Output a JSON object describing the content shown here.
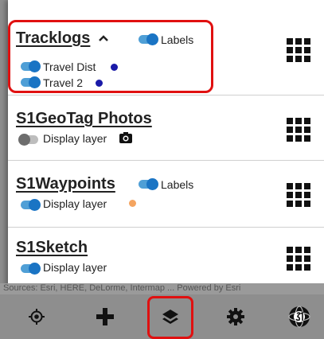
{
  "layers": [
    {
      "title": "Tracklogs",
      "labels_toggle": {
        "label": "Labels",
        "on": true
      },
      "tracks": [
        {
          "label": "Travel Dist",
          "on": true,
          "color": "#1a1aa8"
        },
        {
          "label": "Travel 2",
          "on": true,
          "color": "#1a1aa8"
        }
      ],
      "expanded": true,
      "highlighted": true
    },
    {
      "title": "S1GeoTag Photos",
      "display_toggle": {
        "label": "Display layer",
        "on": false
      }
    },
    {
      "title": "S1Waypoints",
      "labels_toggle": {
        "label": "Labels",
        "on": true
      },
      "display_toggle": {
        "label": "Display layer",
        "on": true
      },
      "color": "#f4a460"
    },
    {
      "title": "S1Sketch",
      "display_toggle": {
        "label": "Display layer",
        "on": true
      }
    }
  ],
  "attribution": "Sources: Esri, HERE, DeLorme, Intermap ... Powered by Esri",
  "toolbar": {
    "buttons": [
      {
        "icon": "gps-target-icon"
      },
      {
        "icon": "add-icon"
      },
      {
        "icon": "layers-icon",
        "active": true
      },
      {
        "icon": "settings-gear-icon"
      },
      {
        "icon": "s1-logo-icon"
      }
    ]
  },
  "colors": {
    "toggle_on_track": "#4f9fd6",
    "toggle_on_knob": "#1a74c4",
    "highlight": "#e01010",
    "toolbar_bg": "#8e8e8e"
  }
}
